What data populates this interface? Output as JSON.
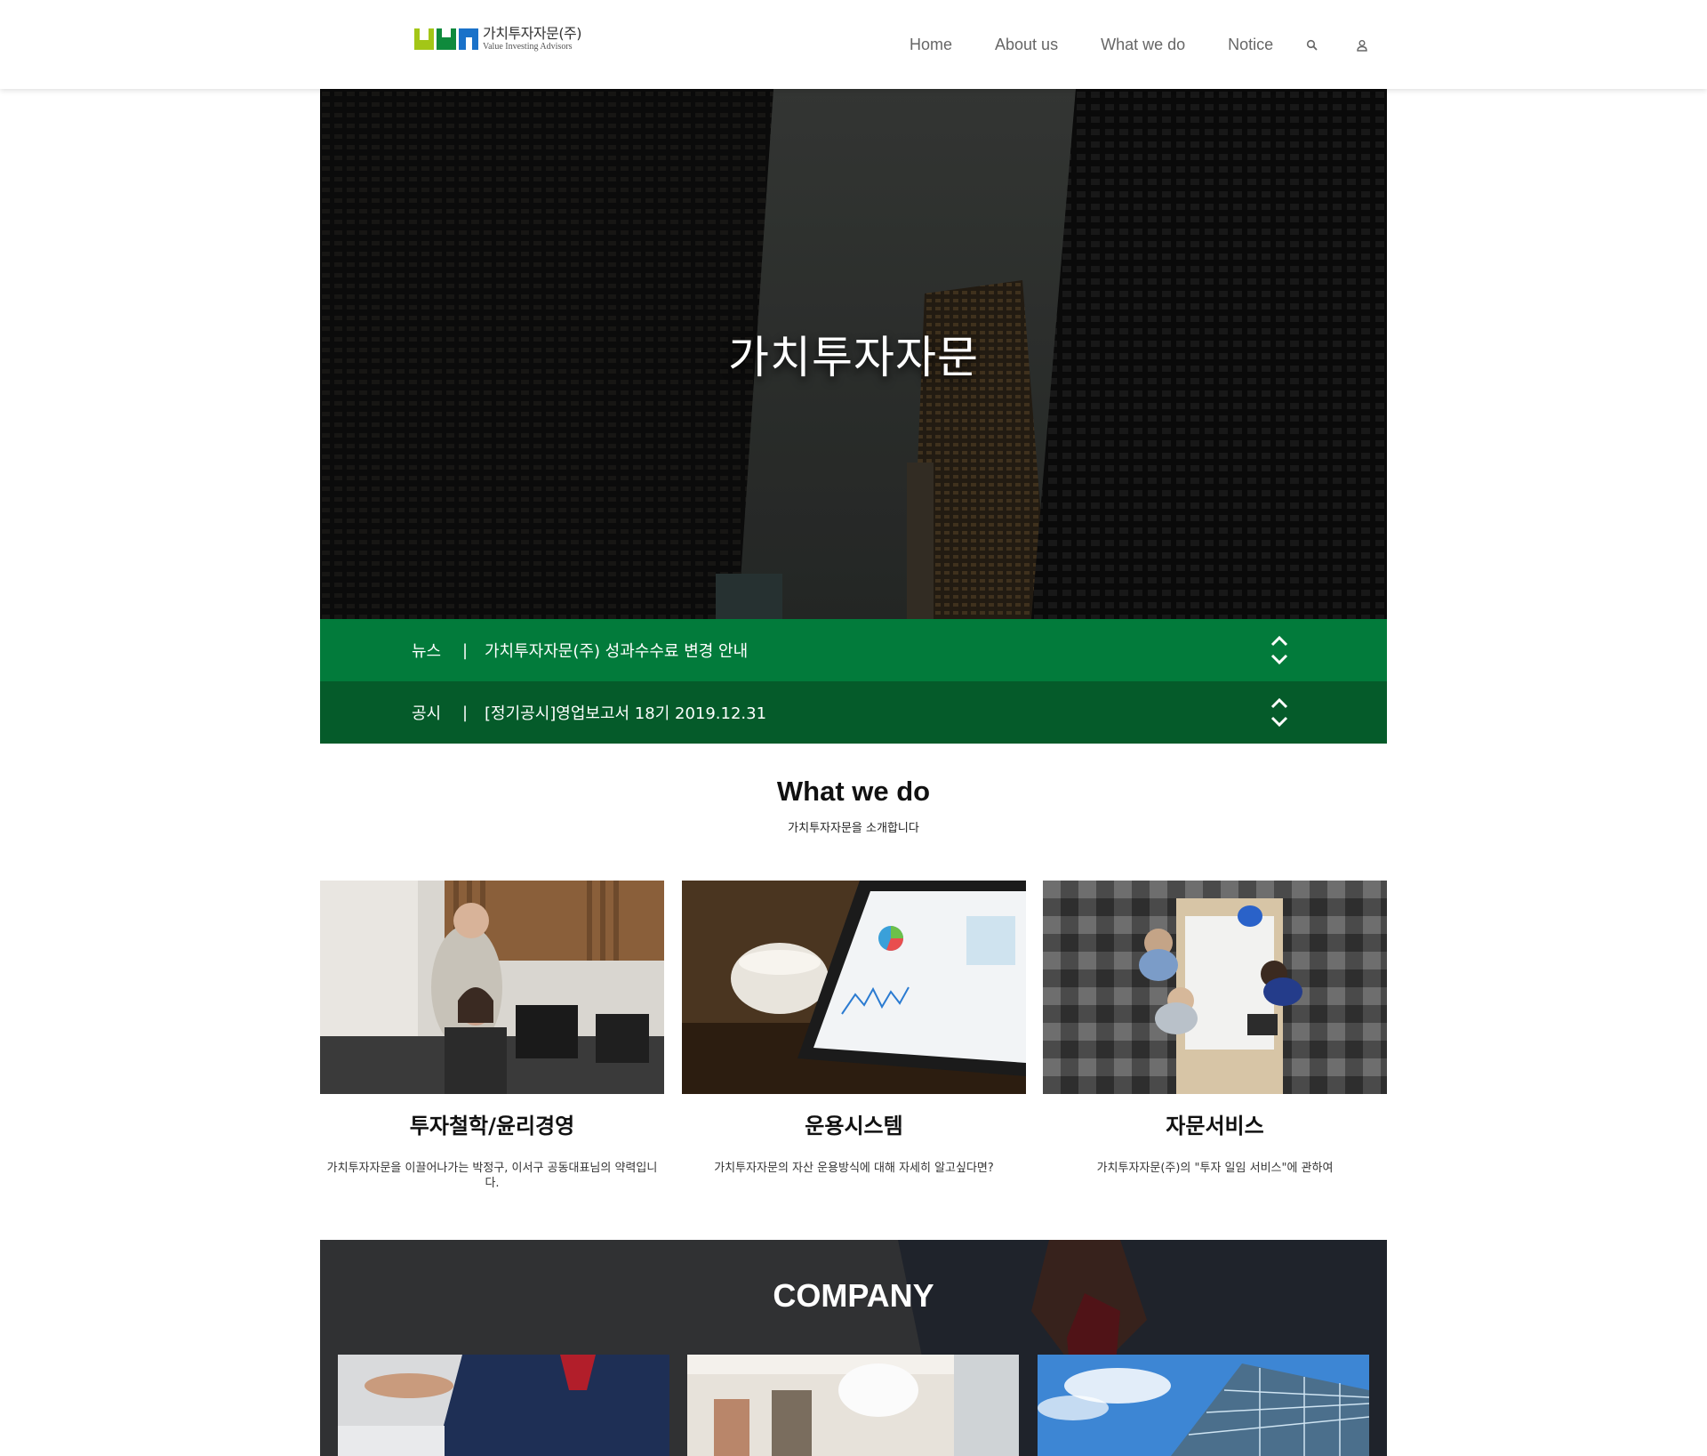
{
  "header": {
    "logo_ko": "가치투자자문(주)",
    "logo_en": "Value Investing Advisors",
    "nav": [
      "Home",
      "About us",
      "What we do",
      "Notice"
    ],
    "icons": [
      "search-icon",
      "user-icon"
    ]
  },
  "hero": {
    "title": "가치투자자문"
  },
  "ticker": {
    "news": {
      "label": "뉴스",
      "separator": "|",
      "text": "가치투자자문(주) 성과수수료 변경 안내"
    },
    "notice": {
      "label": "공시",
      "separator": "|",
      "text": "[정기공시]영업보고서 18기 2019.12.31"
    }
  },
  "what_we_do": {
    "title": "What we do",
    "subtitle": "가치투자자문을 소개합니다",
    "cards": [
      {
        "title": "투자철학/윤리경영",
        "desc": "가치투자자문을 이끌어나가는 박정구, 이서구 공동대표님의 약력입니다."
      },
      {
        "title": "운용시스템",
        "desc": "가치투자자문의 자산 운용방식에 대해 자세히 알고싶다면?"
      },
      {
        "title": "자문서비스",
        "desc": "가치투자자문(주)의 \"투자 일임 서비스\"에 관하여"
      }
    ]
  },
  "company": {
    "title": "COMPANY"
  },
  "colors": {
    "news_bar": "#027b3b",
    "notice_bar": "#055b2a",
    "logo_green_light": "#a3c617",
    "logo_green": "#0f8a3c",
    "logo_blue": "#1a72c9"
  }
}
